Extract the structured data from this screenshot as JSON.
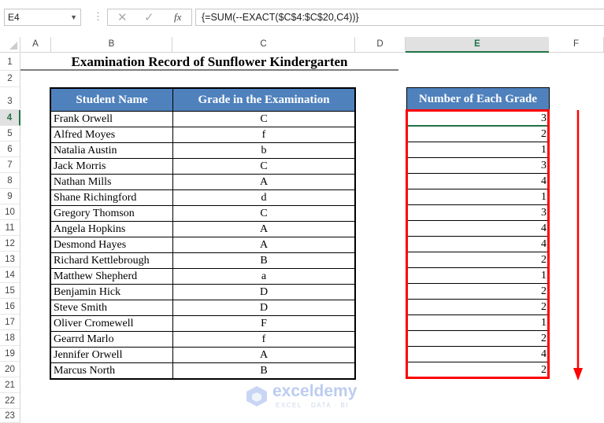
{
  "formula_bar": {
    "name_box": "E4",
    "formula": "{=SUM(--EXACT($C$4:$C$20,C4))}",
    "cancel_icon": "✕",
    "enter_icon": "✓",
    "fx_label": "fx"
  },
  "columns": [
    "A",
    "B",
    "C",
    "D",
    "E",
    "F"
  ],
  "selected_column": "E",
  "rows": [
    "1",
    "2",
    "3",
    "4",
    "5",
    "6",
    "7",
    "8",
    "9",
    "10",
    "11",
    "12",
    "13",
    "14",
    "15",
    "16",
    "17",
    "18",
    "19",
    "20",
    "21",
    "22",
    "23"
  ],
  "selected_row": "4",
  "sheet": {
    "title": "Examination Record of Sunflower Kindergarten",
    "headers": {
      "name": "Student Name",
      "grade": "Grade in the Examination",
      "count": "Number of Each Grade"
    },
    "records": [
      {
        "name": "Frank Orwell",
        "grade": "C",
        "count": "3"
      },
      {
        "name": "Alfred Moyes",
        "grade": "f",
        "count": "2"
      },
      {
        "name": "Natalia Austin",
        "grade": "b",
        "count": "1"
      },
      {
        "name": "Jack Morris",
        "grade": "C",
        "count": "3"
      },
      {
        "name": "Nathan Mills",
        "grade": "A",
        "count": "4"
      },
      {
        "name": "Shane Richingford",
        "grade": "d",
        "count": "1"
      },
      {
        "name": "Gregory Thomson",
        "grade": "C",
        "count": "3"
      },
      {
        "name": "Angela Hopkins",
        "grade": "A",
        "count": "4"
      },
      {
        "name": "Desmond Hayes",
        "grade": "A",
        "count": "4"
      },
      {
        "name": "Richard Kettlebrough",
        "grade": "B",
        "count": "2"
      },
      {
        "name": "Matthew Shepherd",
        "grade": "a",
        "count": "1"
      },
      {
        "name": "Benjamin Hick",
        "grade": "D",
        "count": "2"
      },
      {
        "name": "Steve Smith",
        "grade": "D",
        "count": "2"
      },
      {
        "name": "Oliver Cromewell",
        "grade": "F",
        "count": "1"
      },
      {
        "name": "Gearrd Marlo",
        "grade": "f",
        "count": "2"
      },
      {
        "name": "Jennifer Orwell",
        "grade": "A",
        "count": "4"
      },
      {
        "name": "Marcus North",
        "grade": "B",
        "count": "2"
      }
    ]
  },
  "annotation": {
    "highlight_color": "#ff0000",
    "arrow": "down-arrow"
  },
  "colors": {
    "header_fill": "#4f81bd",
    "selection_green": "#217346"
  },
  "watermark": {
    "brand": "exceldemy",
    "tagline": "EXCEL · DATA · BI"
  }
}
